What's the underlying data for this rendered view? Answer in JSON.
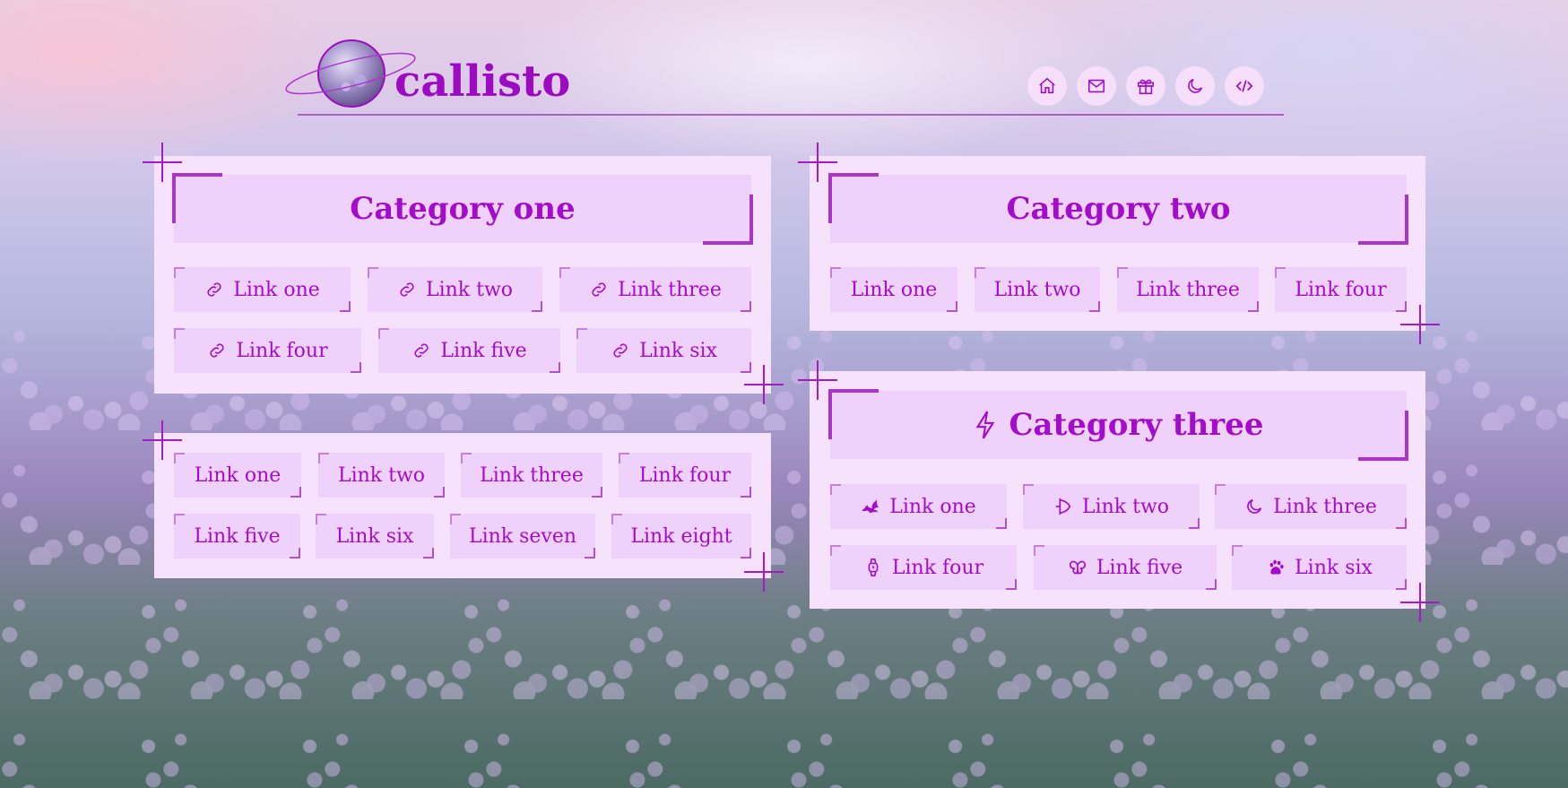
{
  "header": {
    "title": "callisto",
    "nav": [
      {
        "icon": "home-icon"
      },
      {
        "icon": "mail-icon"
      },
      {
        "icon": "gift-icon"
      },
      {
        "icon": "moon-icon"
      },
      {
        "icon": "code-icon"
      }
    ]
  },
  "colors": {
    "accent": "#a30ccb",
    "panel": "#f7e2fd",
    "tile": "#efd2fb"
  },
  "category_one": {
    "title": "Category one",
    "links": [
      "Link one",
      "Link two",
      "Link three",
      "Link four",
      "Link five",
      "Link six"
    ],
    "icon": "link-icon"
  },
  "uncategorized": {
    "links": [
      "Link one",
      "Link two",
      "Link three",
      "Link four",
      "Link five",
      "Link six",
      "Link seven",
      "Link eight"
    ]
  },
  "category_two": {
    "title": "Category two",
    "links": [
      "Link one",
      "Link two",
      "Link three",
      "Link four"
    ]
  },
  "category_three": {
    "title": "Category three",
    "title_icon": "lightning-icon",
    "links": [
      {
        "label": "Link one",
        "icon": "dragon-icon"
      },
      {
        "label": "Link two",
        "icon": "plane-icon"
      },
      {
        "label": "Link three",
        "icon": "moon-icon"
      },
      {
        "label": "Link four",
        "icon": "watch-icon"
      },
      {
        "label": "Link five",
        "icon": "butterfly-icon"
      },
      {
        "label": "Link six",
        "icon": "paw-icon"
      }
    ]
  }
}
